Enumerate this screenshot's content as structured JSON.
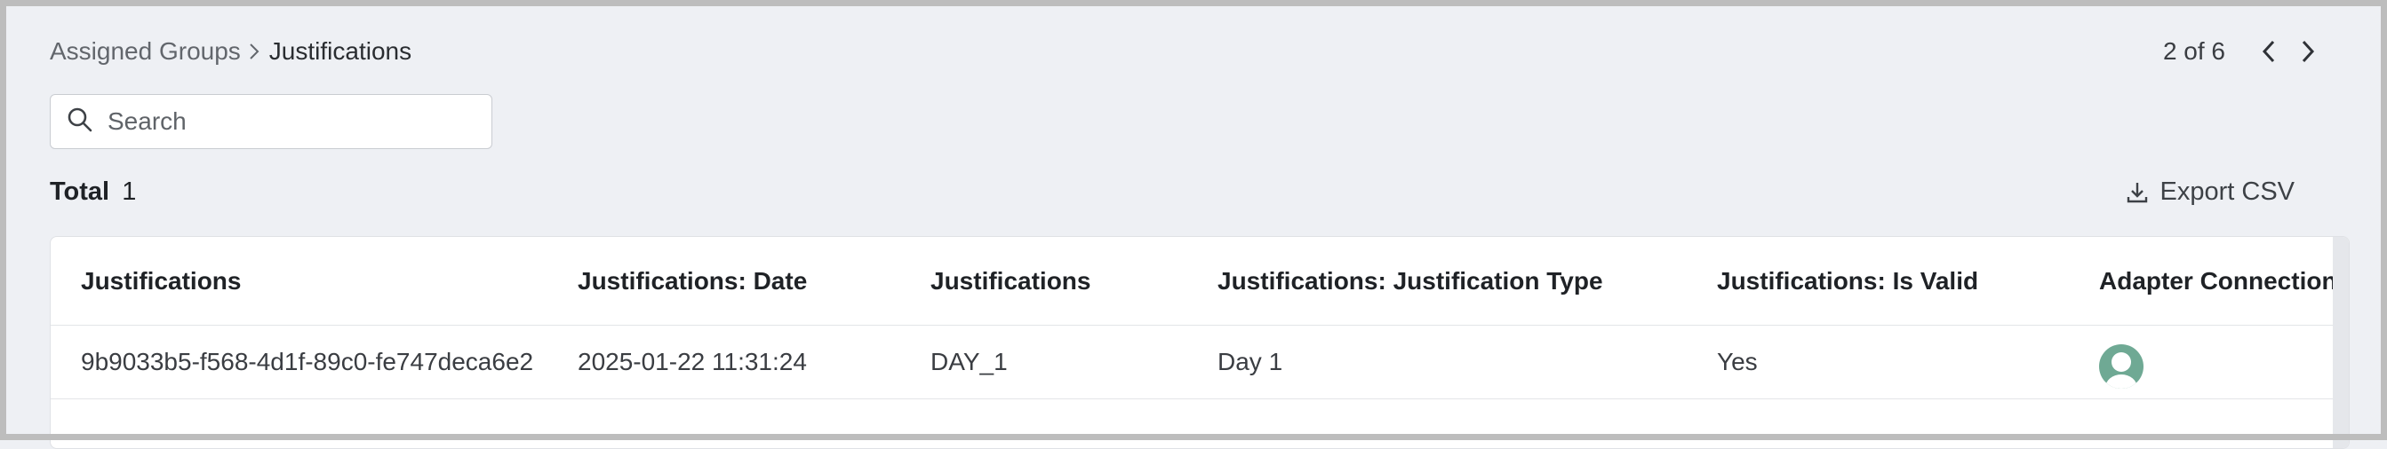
{
  "breadcrumb": {
    "parent": "Assigned Groups",
    "current": "Justifications"
  },
  "pager": {
    "text": "2 of 6"
  },
  "search": {
    "placeholder": "Search",
    "value": ""
  },
  "summary": {
    "total_label": "Total",
    "total_count": "1"
  },
  "toolbar": {
    "export_label": "Export CSV"
  },
  "table": {
    "columns": [
      "Justifications",
      "Justifications: Date",
      "Justifications",
      "Justifications: Justification Type",
      "Justifications: Is Valid",
      "Adapter Connections"
    ],
    "rows": [
      [
        "9b9033b5-f568-4d1f-89c0-fe747deca6e2",
        "2025-01-22 11:31:24",
        "DAY_1",
        "Day 1",
        "Yes",
        "user-avatar-icon"
      ]
    ]
  },
  "colors": {
    "background": "#eef0f4",
    "avatar": "#6fa994",
    "border": "#dfe1e5"
  }
}
